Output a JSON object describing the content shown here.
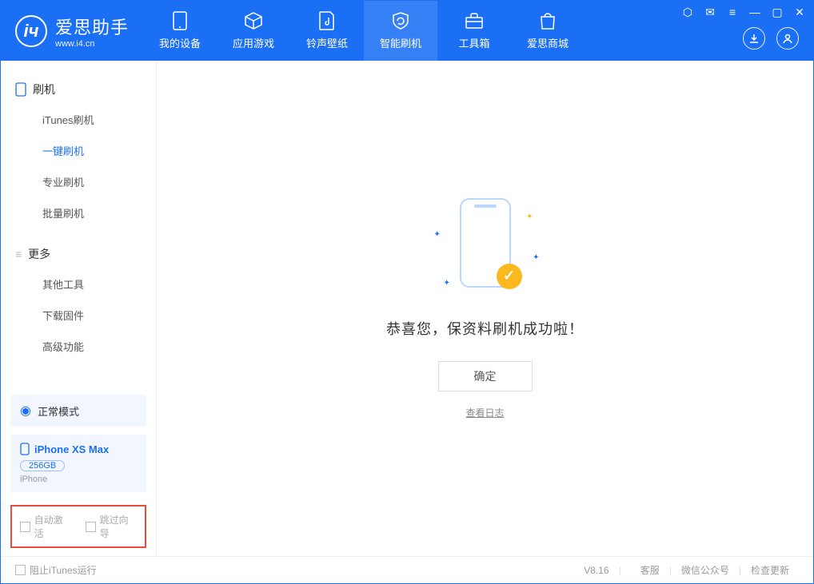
{
  "app": {
    "logo_title": "爱思助手",
    "logo_sub": "www.i4.cn"
  },
  "nav": {
    "tabs": [
      {
        "label": "我的设备"
      },
      {
        "label": "应用游戏"
      },
      {
        "label": "铃声壁纸"
      },
      {
        "label": "智能刷机"
      },
      {
        "label": "工具箱"
      },
      {
        "label": "爱思商城"
      }
    ],
    "active_index": 3
  },
  "sidebar": {
    "groups": [
      {
        "title": "刷机",
        "items": [
          {
            "label": "iTunes刷机"
          },
          {
            "label": "一键刷机"
          },
          {
            "label": "专业刷机"
          },
          {
            "label": "批量刷机"
          }
        ],
        "active_index": 1
      },
      {
        "title": "更多",
        "items": [
          {
            "label": "其他工具"
          },
          {
            "label": "下载固件"
          },
          {
            "label": "高级功能"
          }
        ],
        "active_index": -1
      }
    ],
    "mode_label": "正常模式",
    "device": {
      "name": "iPhone XS Max",
      "capacity": "256GB",
      "type": "iPhone"
    },
    "options": {
      "auto_activate": "自动激活",
      "skip_guide": "跳过向导"
    }
  },
  "main": {
    "success_text": "恭喜您，保资料刷机成功啦！",
    "ok_label": "确定",
    "view_log": "查看日志"
  },
  "footer": {
    "block_itunes": "阻止iTunes运行",
    "version": "V8.16",
    "links": [
      "客服",
      "微信公众号",
      "检查更新"
    ]
  }
}
